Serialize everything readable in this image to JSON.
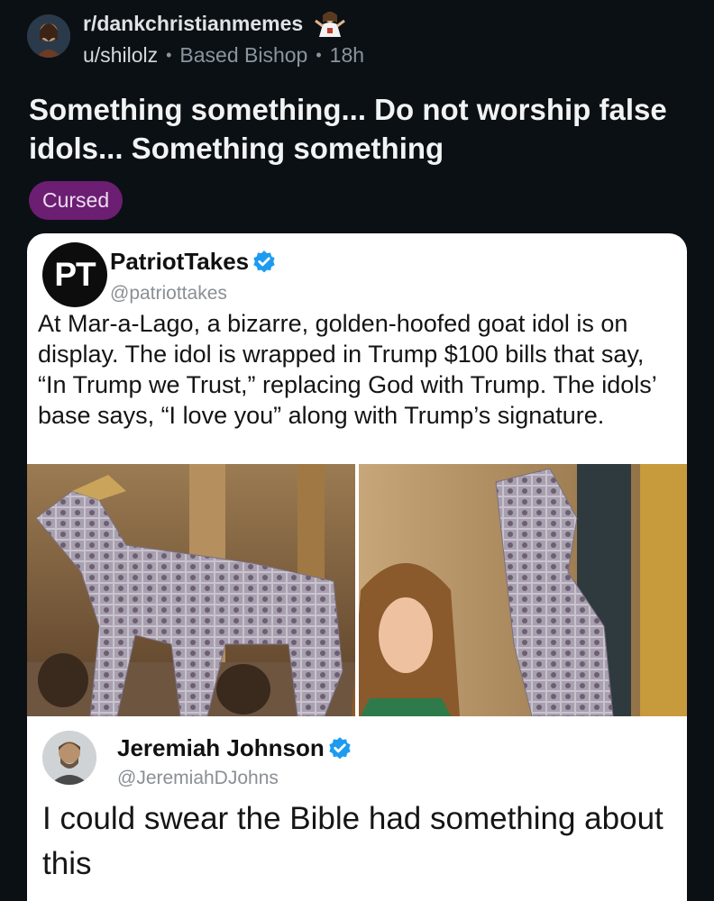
{
  "post": {
    "subreddit": "r/dankchristianmemes",
    "author": "u/shilolz",
    "user_flair": "Based Bishop",
    "age": "18h",
    "title": "Something something... Do not worship false idols... Something something",
    "flair": "Cursed"
  },
  "tweet": {
    "logo_text": "PT",
    "name": "PatriotTakes",
    "handle": "@patriottakes",
    "text": "At Mar-a-Lago, a bizarre, golden-hoofed goat idol is on display. The idol is wrapped in Trump $100 bills that say, “In Trump we Trust,” replacing God with Trump. The idols’ base says, “I love you” along with Trump’s signature."
  },
  "reply": {
    "name": "Jeremiah Johnson",
    "handle": "@JeremiahDJohns",
    "text": "I could swear the Bible had something about this"
  },
  "colors": {
    "background": "#0b1014",
    "flair_bg": "#6b1e72",
    "verified_blue": "#1d9bf0"
  },
  "icons": [
    "subreddit-avatar-icon",
    "subreddit-jesus-icon",
    "verified-badge-icon"
  ]
}
